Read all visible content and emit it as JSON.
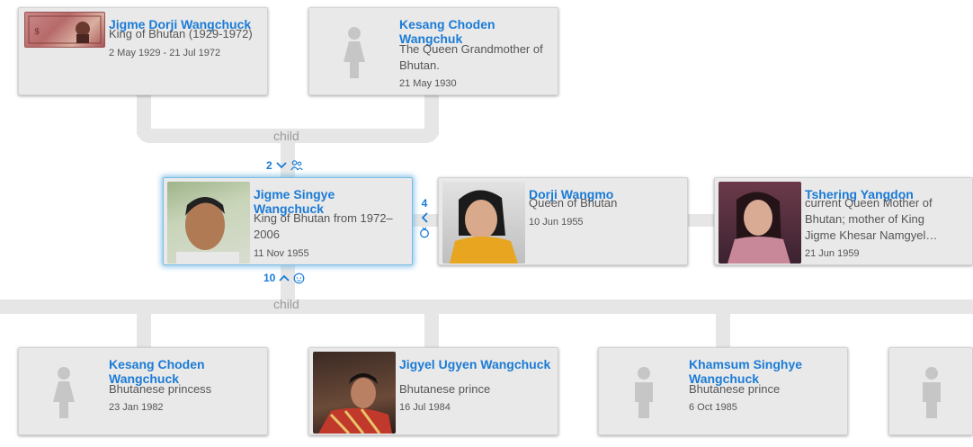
{
  "colors": {
    "accent": "#1a7bd6",
    "connector": "#e6e6e6",
    "selected_glow": "#7bbde6"
  },
  "parents": [
    {
      "name": "Jigme Dorji Wangchuck",
      "desc": "King of Bhutan (1929-1972)",
      "date": "2 May 1929 - 21 Jul 1972",
      "photo": "banknote-portrait"
    },
    {
      "name": "Kesang Choden Wangchuk",
      "desc": "The Queen Grandmother of Bhutan.",
      "date": "21 May 1930",
      "photo": "female-silhouette-icon"
    }
  ],
  "parent_link_label": "child",
  "children_link_label": "child",
  "focus": {
    "name": "Jigme Singye Wangchuck",
    "desc": "King of Bhutan from 1972–2006",
    "date": "11 Nov 1955",
    "siblings_count": "2",
    "spouses_count": "4",
    "children_count": "10"
  },
  "spouses": [
    {
      "name": "Dorji Wangmo",
      "desc": "Queen of Bhutan",
      "date": "10 Jun 1955"
    },
    {
      "name": "Tshering Yangdon",
      "desc": "current Queen Mother of Bhutan; mother of King Jigme Khesar Namgyel…",
      "date": "21 Jun 1959"
    }
  ],
  "children": [
    {
      "name": "Kesang Choden Wangchuck",
      "desc": "Bhutanese princess",
      "date": "23 Jan 1982",
      "photo": "female-silhouette-icon"
    },
    {
      "name": "Jigyel Ugyen Wangchuck",
      "desc": "Bhutanese prince",
      "date": "16 Jul 1984",
      "photo": "portrait"
    },
    {
      "name": "Khamsum Singhye Wangchuck",
      "desc": "Bhutanese prince",
      "date": "6 Oct 1985",
      "photo": "male-silhouette-icon"
    },
    {
      "name": "",
      "desc": "",
      "date": "",
      "photo": "male-silhouette-icon"
    }
  ]
}
